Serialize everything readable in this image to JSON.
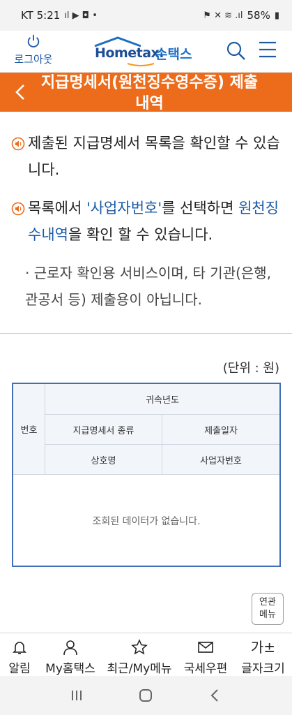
{
  "status_bar": {
    "carrier_time": "KT 5:21",
    "battery": "58%"
  },
  "header": {
    "logout_label": "로그아웃",
    "logo_main": "Hometax.",
    "logo_sub": "손택스"
  },
  "title_bar": {
    "title": "지급명세서(원천징수영수증) 제출내역"
  },
  "notes": {
    "note1": "제출된 지급명세서 목록을 확인할 수 있습니다.",
    "note2_part1": "목록에서 ",
    "note2_highlight1": "'사업자번호'",
    "note2_part2": "를 선택하면 ",
    "note2_highlight2": "원천징수내역",
    "note2_part3": "을 확인 할 수 있습니다.",
    "sub_note": "· 근로자 확인용 서비스이며, 타 기관(은행, 관공서 등) 제출용이 아닙니다."
  },
  "unit_label": "(단위 : 원)",
  "table": {
    "col_number": "번호",
    "col_year": "귀속년도",
    "col_type": "지급명세서 종류",
    "col_date": "제출일자",
    "col_company": "상호명",
    "col_bizno": "사업자번호",
    "empty_message": "조회된 데이터가 없습니다."
  },
  "related_button": {
    "line1": "연관",
    "line2": "메뉴"
  },
  "bottom_nav": {
    "items": [
      {
        "label": "알림",
        "icon": "bell-icon"
      },
      {
        "label": "My홈택스",
        "icon": "person-icon"
      },
      {
        "label": "최근/My메뉴",
        "icon": "star-icon"
      },
      {
        "label": "국세우편",
        "icon": "mail-icon"
      },
      {
        "label": "글자크기",
        "icon": "font-size-icon",
        "glyph": "가±"
      }
    ]
  }
}
